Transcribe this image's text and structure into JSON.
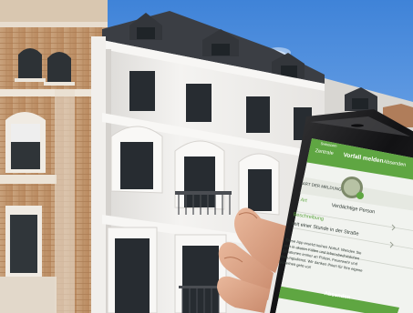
{
  "phone": {
    "carrier": "Swisscom",
    "time": "09:41",
    "nav_back": "Zentrale",
    "nav_title": "Vorfall melden",
    "nav_action": "Absenden",
    "section_label": "ART DER MELDUNG",
    "row_type_label": "Art",
    "row_type_value": "Verdächtige Person",
    "row_desc_label": "Beschreibung",
    "row_desc_value": "seit einer Stunde in der Straße",
    "note_line_1": "Diese App ersetzt keinen Notruf. Wenden Sie",
    "note_line_2": "sich in akuten Fällen und lebensbedrohlichen",
    "note_line_3": "Situationen immer an Polizei, Feuerwehr und",
    "note_line_4": "Rettungsdienst. Wir danken Ihnen für Ihre eigene",
    "note_line_5": "Sicherheit geht vor!",
    "submit_button": "Absenden",
    "colors": {
      "accent": "#5fa642",
      "screen_bg": "#f1f3ef"
    }
  }
}
